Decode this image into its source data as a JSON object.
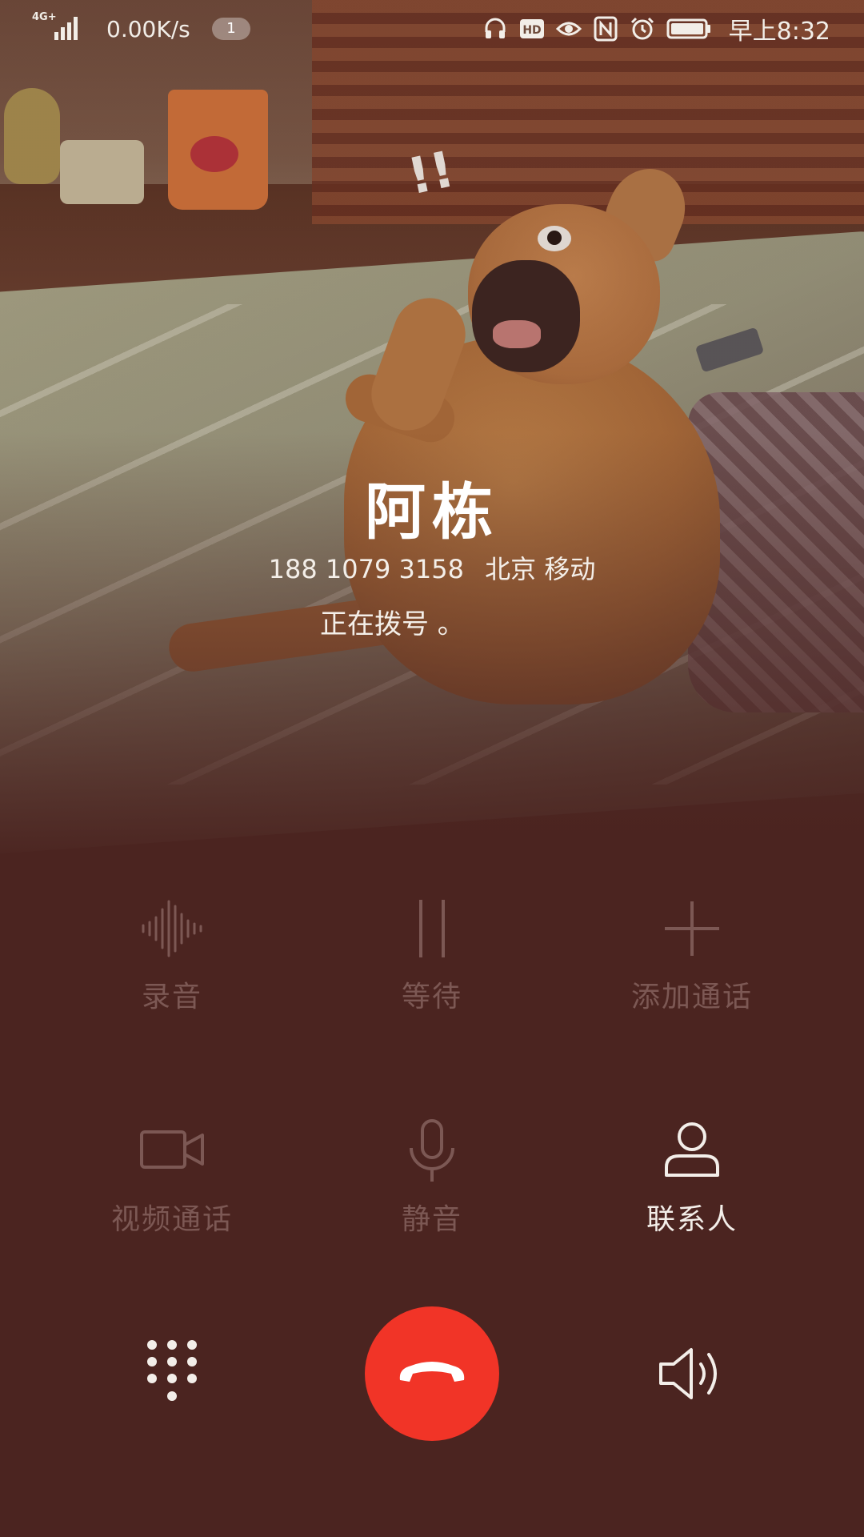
{
  "status_bar": {
    "network_label": "4G+",
    "network_speed": "0.00K/s",
    "notification_count": "1",
    "time": "早上8:32",
    "icons": [
      "headphones-icon",
      "hd-icon",
      "eye-icon",
      "nfc-icon",
      "alarm-icon",
      "battery-icon"
    ]
  },
  "call": {
    "caller_name": "阿栋",
    "phone_number": "188 1079 3158",
    "location": "北京 移动",
    "status": "正在拨号 。"
  },
  "controls": {
    "record": {
      "label": "录音",
      "icon": "waveform-icon",
      "enabled": false
    },
    "hold": {
      "label": "等待",
      "icon": "pause-icon",
      "enabled": false
    },
    "add_call": {
      "label": "添加通话",
      "icon": "plus-icon",
      "enabled": false
    },
    "video_call": {
      "label": "视频通话",
      "icon": "video-camera-icon",
      "enabled": false
    },
    "mute": {
      "label": "静音",
      "icon": "microphone-icon",
      "enabled": false
    },
    "contacts": {
      "label": "联系人",
      "icon": "person-icon",
      "enabled": true
    }
  },
  "bottom_bar": {
    "dialpad_icon": "dialpad-icon",
    "hangup_icon": "hangup-phone-icon",
    "speaker_icon": "speaker-icon"
  },
  "colors": {
    "background": "#4b2420",
    "hangup": "#f13427",
    "disabled_text": "#7c5854",
    "active_text": "#f3eee9"
  }
}
